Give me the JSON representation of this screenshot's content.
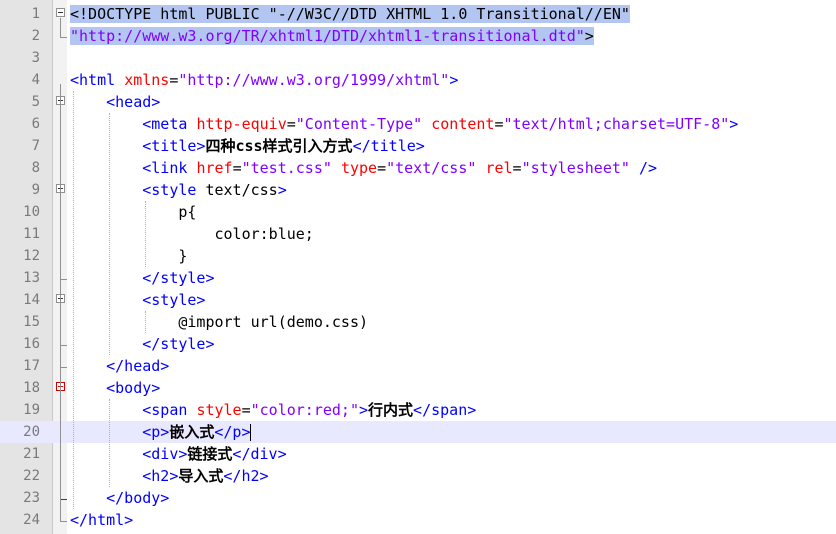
{
  "editor": {
    "current_line": 20,
    "lines": [
      {
        "n": "1",
        "tokens": [
          [
            "doc",
            "<!DOCTYPE html PUBLIC \"-//W3C//DTD XHTML 1.0 Transitional//EN\""
          ]
        ]
      },
      {
        "n": "2",
        "tokens": [
          [
            "val",
            "\"http://www.w3.org/TR/xhtml1/DTD/xhtml1-transitional.dtd\""
          ],
          [
            "doc",
            ">"
          ]
        ]
      },
      {
        "n": "3",
        "tokens": []
      },
      {
        "n": "4",
        "tokens": [
          [
            "tag",
            "<html "
          ],
          [
            "attr",
            "xmlns"
          ],
          [
            "text",
            "="
          ],
          [
            "val",
            "\"http://www.w3.org/1999/xhtml\""
          ],
          [
            "tag",
            ">"
          ]
        ]
      },
      {
        "n": "5",
        "tokens": [
          [
            "text",
            "    "
          ],
          [
            "tag",
            "<head>"
          ]
        ]
      },
      {
        "n": "6",
        "tokens": [
          [
            "text",
            "        "
          ],
          [
            "tag",
            "<meta "
          ],
          [
            "attr",
            "http-equiv"
          ],
          [
            "text",
            "="
          ],
          [
            "val",
            "\"Content-Type\""
          ],
          [
            "text",
            " "
          ],
          [
            "attr",
            "content"
          ],
          [
            "text",
            "="
          ],
          [
            "val",
            "\"text/html;charset=UTF-8\""
          ],
          [
            "tag",
            ">"
          ]
        ]
      },
      {
        "n": "7",
        "tokens": [
          [
            "text",
            "        "
          ],
          [
            "tag",
            "<title>"
          ],
          [
            "cjk",
            "四种css样式引入方式"
          ],
          [
            "tag",
            "</title>"
          ]
        ]
      },
      {
        "n": "8",
        "tokens": [
          [
            "text",
            "        "
          ],
          [
            "tag",
            "<link "
          ],
          [
            "attr",
            "href"
          ],
          [
            "text",
            "="
          ],
          [
            "val",
            "\"test.css\""
          ],
          [
            "text",
            " "
          ],
          [
            "attr",
            "type"
          ],
          [
            "text",
            "="
          ],
          [
            "val",
            "\"text/css\""
          ],
          [
            "text",
            " "
          ],
          [
            "attr",
            "rel"
          ],
          [
            "text",
            "="
          ],
          [
            "val",
            "\"stylesheet\""
          ],
          [
            "text",
            " "
          ],
          [
            "tag",
            "/>"
          ]
        ]
      },
      {
        "n": "9",
        "tokens": [
          [
            "text",
            "        "
          ],
          [
            "tag",
            "<style "
          ],
          [
            "text",
            "text/css"
          ],
          [
            "tag",
            ">"
          ]
        ]
      },
      {
        "n": "10",
        "tokens": [
          [
            "text",
            "            p{"
          ]
        ]
      },
      {
        "n": "11",
        "tokens": [
          [
            "text",
            "                color:blue;"
          ]
        ]
      },
      {
        "n": "12",
        "tokens": [
          [
            "text",
            "            }"
          ]
        ]
      },
      {
        "n": "13",
        "tokens": [
          [
            "text",
            "        "
          ],
          [
            "tag",
            "</style>"
          ]
        ]
      },
      {
        "n": "14",
        "tokens": [
          [
            "text",
            "        "
          ],
          [
            "tag",
            "<style>"
          ]
        ]
      },
      {
        "n": "15",
        "tokens": [
          [
            "text",
            "            @import url(demo.css)"
          ]
        ]
      },
      {
        "n": "16",
        "tokens": [
          [
            "text",
            "        "
          ],
          [
            "tag",
            "</style>"
          ]
        ]
      },
      {
        "n": "17",
        "tokens": [
          [
            "text",
            "    "
          ],
          [
            "tag",
            "</head>"
          ]
        ]
      },
      {
        "n": "18",
        "tokens": [
          [
            "text",
            "    "
          ],
          [
            "tag",
            "<body>"
          ]
        ]
      },
      {
        "n": "19",
        "tokens": [
          [
            "text",
            "        "
          ],
          [
            "tag",
            "<span "
          ],
          [
            "attr",
            "style"
          ],
          [
            "text",
            "="
          ],
          [
            "val",
            "\"color:red;\""
          ],
          [
            "tag",
            ">"
          ],
          [
            "cjk",
            "行内式"
          ],
          [
            "tag",
            "</span>"
          ]
        ]
      },
      {
        "n": "20",
        "tokens": [
          [
            "text",
            "        "
          ],
          [
            "tag",
            "<p>"
          ],
          [
            "cjk",
            "嵌入式"
          ],
          [
            "tag",
            "</p>"
          ]
        ]
      },
      {
        "n": "21",
        "tokens": [
          [
            "text",
            "        "
          ],
          [
            "tag",
            "<div>"
          ],
          [
            "cjk",
            "链接式"
          ],
          [
            "tag",
            "</div>"
          ]
        ]
      },
      {
        "n": "22",
        "tokens": [
          [
            "text",
            "        "
          ],
          [
            "tag",
            "<h2>"
          ],
          [
            "cjk",
            "导入式"
          ],
          [
            "tag",
            "</h2>"
          ]
        ]
      },
      {
        "n": "23",
        "tokens": [
          [
            "text",
            "    "
          ],
          [
            "tag",
            "</body>"
          ]
        ]
      },
      {
        "n": "24",
        "tokens": [
          [
            "tag",
            "</html>"
          ]
        ]
      }
    ]
  },
  "colors": {
    "tag": "#0000ff",
    "attr": "#ff0000",
    "attr_value": "#8000ff",
    "text": "#000000",
    "selection": "#b3c6f2",
    "current_line": "#e8e8ff",
    "gutter": "#e4e4e4"
  }
}
